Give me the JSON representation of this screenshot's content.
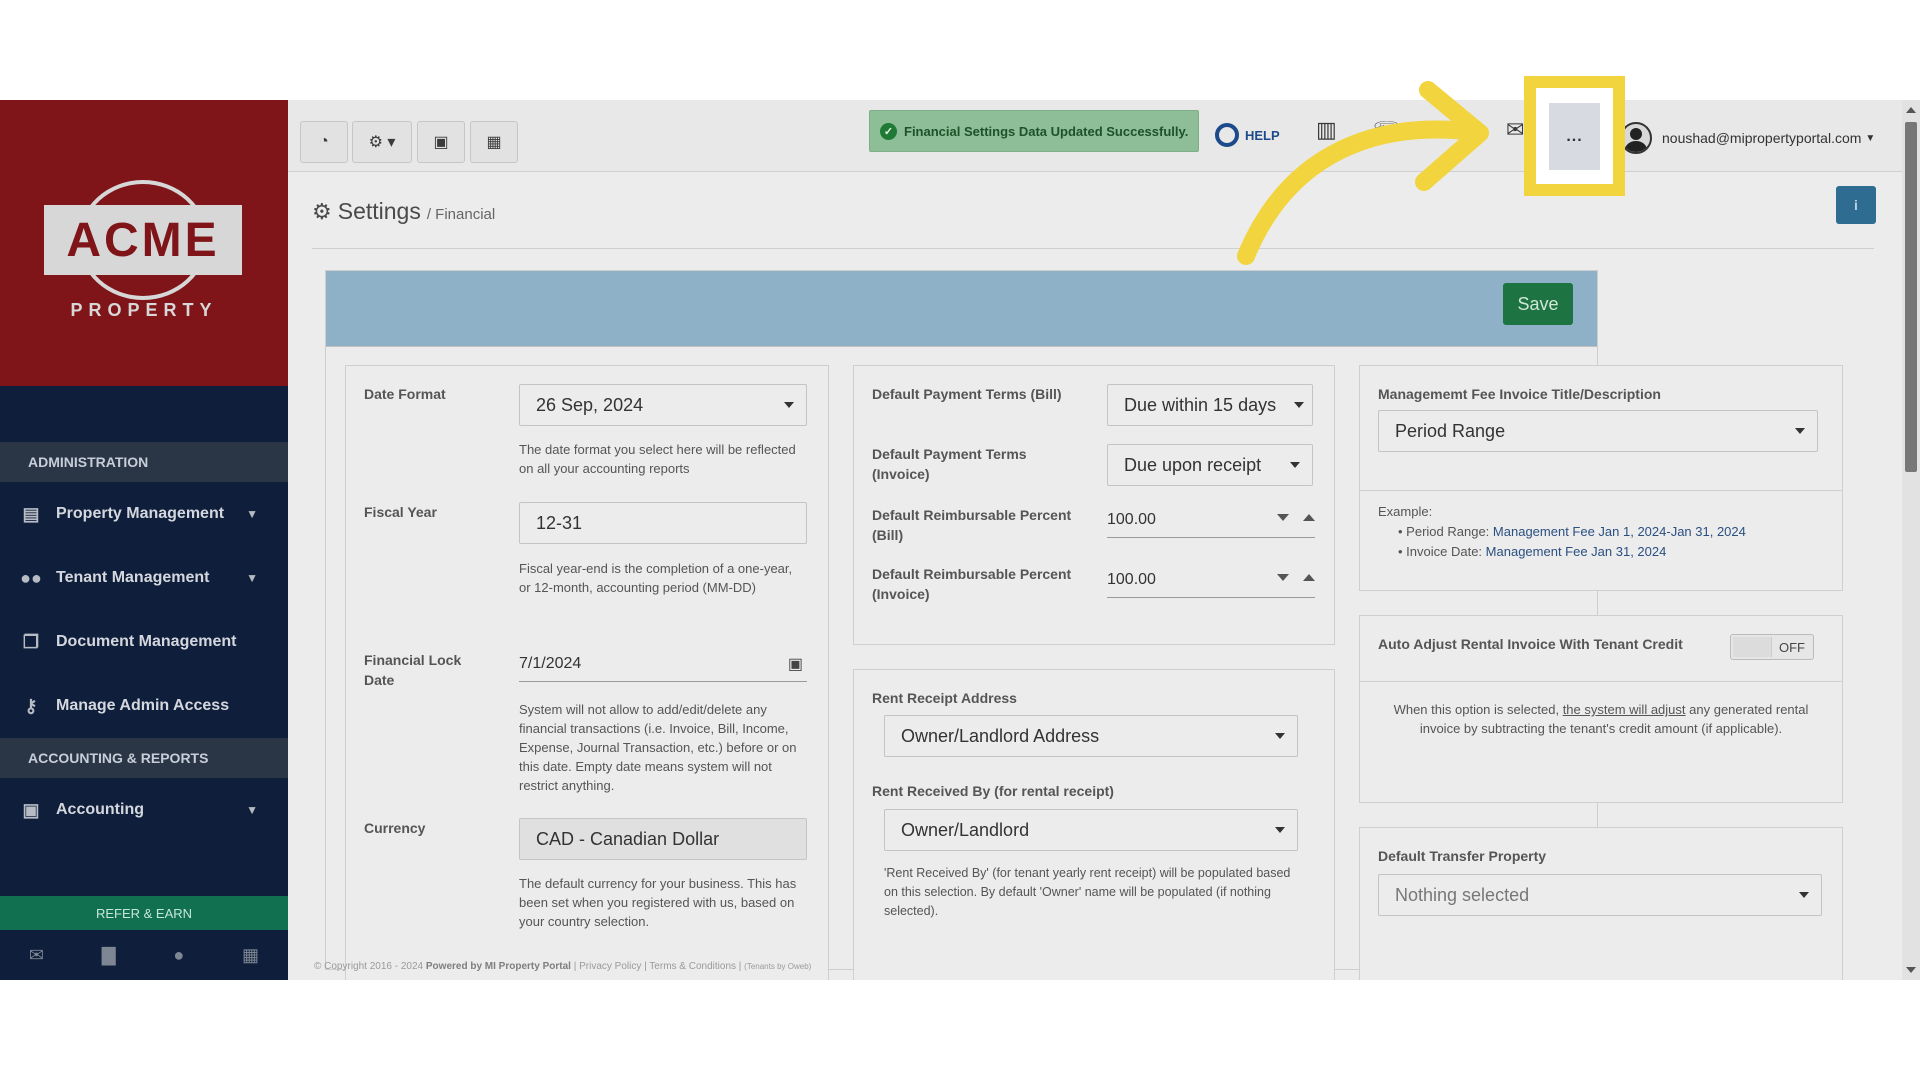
{
  "brand": {
    "name": "ACME",
    "tagline": "PROPERTY"
  },
  "sidebar": {
    "sections": [
      {
        "label": "ADMINISTRATION"
      },
      {
        "label": "ACCOUNTING & REPORTS"
      }
    ],
    "items": [
      {
        "label": "Property Management",
        "icon": "building-icon"
      },
      {
        "label": "Tenant Management",
        "icon": "users-icon"
      },
      {
        "label": "Document Management",
        "icon": "documents-icon"
      },
      {
        "label": "Manage Admin Access",
        "icon": "key-icon"
      },
      {
        "label": "Accounting",
        "icon": "money-icon"
      }
    ],
    "refer": "REFER & EARN"
  },
  "topbar": {
    "alert": "Financial Settings Data Updated Successfully.",
    "help": "HELP",
    "user_email": "noushad@mipropertyportal.com",
    "more_label": "..."
  },
  "page": {
    "title": "Settings",
    "subtitle": "/ Financial",
    "save": "Save"
  },
  "col1": {
    "date_format_label": "Date Format",
    "date_format_value": "26 Sep, 2024",
    "date_format_help": "The date format you select here will be reflected on all your accounting reports",
    "fiscal_label": "Fiscal Year",
    "fiscal_value": "12-31",
    "fiscal_help": "Fiscal year-end is the completion of a one-year, or 12-month, accounting period (MM-DD)",
    "lock_label": "Financial Lock Date",
    "lock_value": "7/1/2024",
    "lock_help": "System will not allow to add/edit/delete any financial transactions (i.e. Invoice, Bill, Income, Expense, Journal Transaction, etc.) before or on this date. Empty date means system will not restrict anything.",
    "currency_label": "Currency",
    "currency_value": "CAD - Canadian Dollar",
    "currency_help": "The default currency for your business. This has been set when you registered with us, based on your country selection."
  },
  "col2": {
    "terms_bill_label": "Default Payment Terms (Bill)",
    "terms_bill_value": "Due within 15 days",
    "terms_inv_label": "Default Payment Terms (Invoice)",
    "terms_inv_value": "Due upon receipt",
    "reimb_bill_label": "Default Reimbursable Percent (Bill)",
    "reimb_bill_value": "100.00",
    "reimb_inv_label": "Default Reimbursable Percent (Invoice)",
    "reimb_inv_value": "100.00",
    "rent_addr_label": "Rent Receipt Address",
    "rent_addr_value": "Owner/Landlord Address",
    "rent_by_label": "Rent Received By (for rental receipt)",
    "rent_by_value": "Owner/Landlord",
    "rent_by_help": "'Rent Received By' (for tenant yearly rent receipt) will be populated based on this selection. By default 'Owner' name will be populated (if nothing selected)."
  },
  "col3": {
    "mgmt_label": "Managememt Fee Invoice Title/Description",
    "mgmt_value": "Period Range",
    "example_label": "Example:",
    "ex1_key": "Period Range:",
    "ex1_val": "Management Fee Jan 1, 2024-Jan 31, 2024",
    "ex2_key": "Invoice Date:",
    "ex2_val": "Management Fee Jan 31, 2024",
    "auto_label": "Auto Adjust Rental Invoice With Tenant Credit",
    "auto_toggle": "OFF",
    "auto_help_pre": "When this option is selected,",
    "auto_help_link": "the system will adjust",
    "auto_help_post": "any generated rental invoice by subtracting the tenant's credit amount (if applicable).",
    "transfer_label": "Default Transfer Property",
    "transfer_value": "Nothing selected"
  },
  "footer": {
    "copyright": "© Copyright 2016 - 2024",
    "powered": "Powered by MI Property Portal",
    "links": "| Privacy Policy | Terms & Conditions |",
    "tenants": "(Tenants by Oweb)"
  },
  "colors": {
    "highlight": "#f2d43f",
    "arrow": "#f2d43f",
    "save": "#1e7342",
    "sidebar": "#0f1e3a",
    "brand": "#7f1419"
  }
}
